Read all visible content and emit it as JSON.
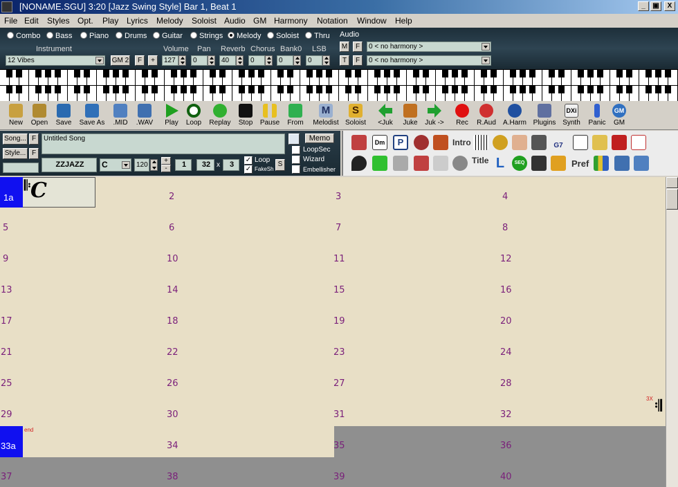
{
  "window": {
    "title": "[NONAME.SGU]   3:20  [Jazz Swing Style]  Bar 1, Beat 1",
    "min_label": "_",
    "max_label": "▣",
    "close_label": "X"
  },
  "menu": [
    "File",
    "Edit",
    "Styles",
    "Opt.",
    "Play",
    "Lyrics",
    "Melody",
    "Soloist",
    "Audio",
    "GM",
    "Harmony",
    "Notation",
    "Window",
    "Help"
  ],
  "tracks": {
    "radios": [
      {
        "label": "Combo",
        "selected": false
      },
      {
        "label": "Bass",
        "selected": false
      },
      {
        "label": "Piano",
        "selected": false
      },
      {
        "label": "Drums",
        "selected": false
      },
      {
        "label": "Guitar",
        "selected": false
      },
      {
        "label": "Strings",
        "selected": false
      },
      {
        "label": "Melody",
        "selected": true
      },
      {
        "label": "Soloist",
        "selected": false
      },
      {
        "label": "Thru",
        "selected": false
      }
    ],
    "audio_label": "Audio"
  },
  "mixer": {
    "instrument_label": "Instrument",
    "instrument_value": "12 Vibes",
    "gm_label": "GM 2",
    "f_label": "F",
    "plus_label": "+",
    "volume_label": "Volume",
    "volume_value": "127",
    "pan_label": "Pan",
    "pan_value": "0",
    "reverb_label": "Reverb",
    "reverb_value": "40",
    "chorus_label": "Chorus",
    "chorus_value": "0",
    "bank_label": "Bank0",
    "bank_value": "0",
    "lsb_label": "LSB",
    "lsb_value": "0"
  },
  "harmony": {
    "m_label": "M",
    "f_label": "F",
    "t_label": "T",
    "f2_label": "F",
    "harmony1": "0 < no harmony >",
    "harmony2": "0 < no harmony >"
  },
  "toolbar": [
    "New",
    "Open",
    "Save",
    "Save As",
    ".MID",
    ".WAV",
    "Play",
    "Loop",
    "Replay",
    "Stop",
    "Pause",
    "From",
    "Melodist",
    "Soloist",
    "<Juk",
    "Juke",
    "Juk ->",
    "Rec",
    "R.Aud",
    "A.Harm",
    "Plugins",
    "Synth",
    "Panic",
    "GM"
  ],
  "toolbar_glyphs": {
    "melodist": "M",
    "soloist": "S",
    "synth": "DXi",
    "gm": "GM"
  },
  "song": {
    "song_btn": "Song...",
    "style_btn": "Style...",
    "f1": "F",
    "f2": "F",
    "title": "Untitled Song",
    "style_name": "ZZJAZZ",
    "key": "C",
    "tempo": "120",
    "start": "1",
    "end": "32",
    "x_label": "x",
    "repeats": "3",
    "loop_label": "Loop",
    "fakesh_label": "FakeSh",
    "s_label": "S",
    "memo_label": "Memo",
    "loopsec_label": "LoopSec",
    "wizard_label": "Wizard",
    "embellisher_label": "Embellisher"
  },
  "icon_panel": {
    "intro_label": "Intro",
    "title_label": "Title",
    "pref_label": "Pref",
    "dm_label": "Dm",
    "p_label": "P",
    "g7_label": "G7",
    "seq_label": "SEQ",
    "l_label": "L"
  },
  "sheet": {
    "first_chord": "C",
    "first_bar_label": "1a",
    "end_bar_label": "33a",
    "end_marker": "end",
    "repeat_marker": "3X",
    "bars": [
      "2",
      "3",
      "4",
      "5",
      "6",
      "7",
      "8",
      "9",
      "10",
      "11",
      "12",
      "13",
      "14",
      "15",
      "16",
      "17",
      "18",
      "19",
      "20",
      "21",
      "22",
      "23",
      "24",
      "25",
      "26",
      "27",
      "28",
      "29",
      "30",
      "31",
      "32",
      "34",
      "35",
      "36",
      "37",
      "38",
      "39",
      "40"
    ]
  }
}
